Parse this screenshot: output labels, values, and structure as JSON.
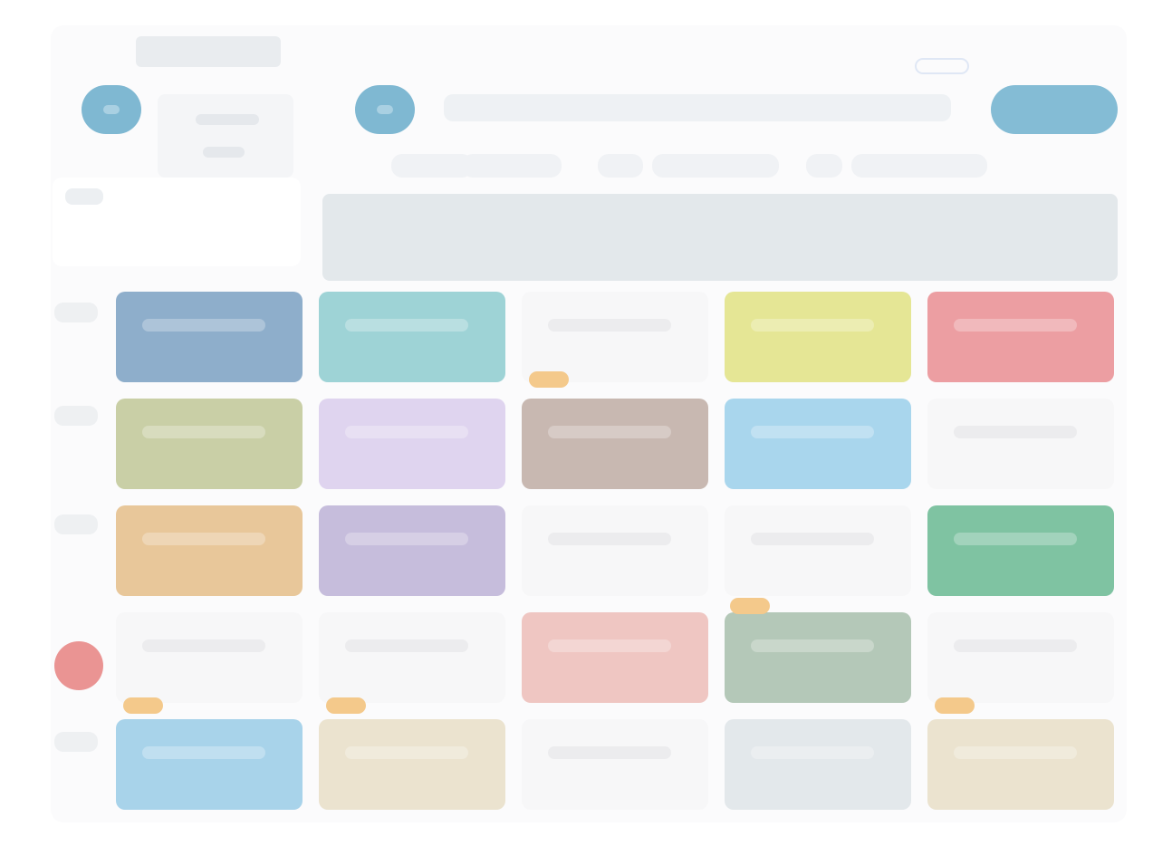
{
  "colors": {
    "accent": "#7fb8d2",
    "header_band": "#e3e8eb",
    "alert": "#ea9493",
    "marker": "#f4c98b"
  },
  "toolbar": {
    "prev_icon": "chevron-left-icon",
    "next_icon": "chevron-right-icon",
    "primary_button_icon": "add-icon"
  },
  "slots": [
    {
      "color": "#8eaecb"
    },
    {
      "color": "#9ed3d6"
    },
    {
      "color": "#f7f7f8"
    },
    {
      "color": "#e5e695"
    },
    {
      "color": "#ec9ea2"
    },
    {
      "color": "#c9cfa6"
    },
    {
      "color": "#dfd4ef"
    },
    {
      "color": "#c8b8b1"
    },
    {
      "color": "#a9d6ed"
    },
    {
      "color": "#f7f7f8"
    },
    {
      "color": "#e8c79a"
    },
    {
      "color": "#c6bddc"
    },
    {
      "color": "#f7f7f8"
    },
    {
      "color": "#f7f7f8"
    },
    {
      "color": "#7fc3a2"
    },
    {
      "color": "#f7f7f8"
    },
    {
      "color": "#f7f7f8"
    },
    {
      "color": "#efc6c2"
    },
    {
      "color": "#b4c8b8"
    },
    {
      "color": "#f7f7f8"
    },
    {
      "color": "#a8d3ea"
    },
    {
      "color": "#ebe3cf"
    },
    {
      "color": "#f7f7f8"
    },
    {
      "color": "#e3e8eb"
    },
    {
      "color": "#ebe3cf"
    }
  ]
}
